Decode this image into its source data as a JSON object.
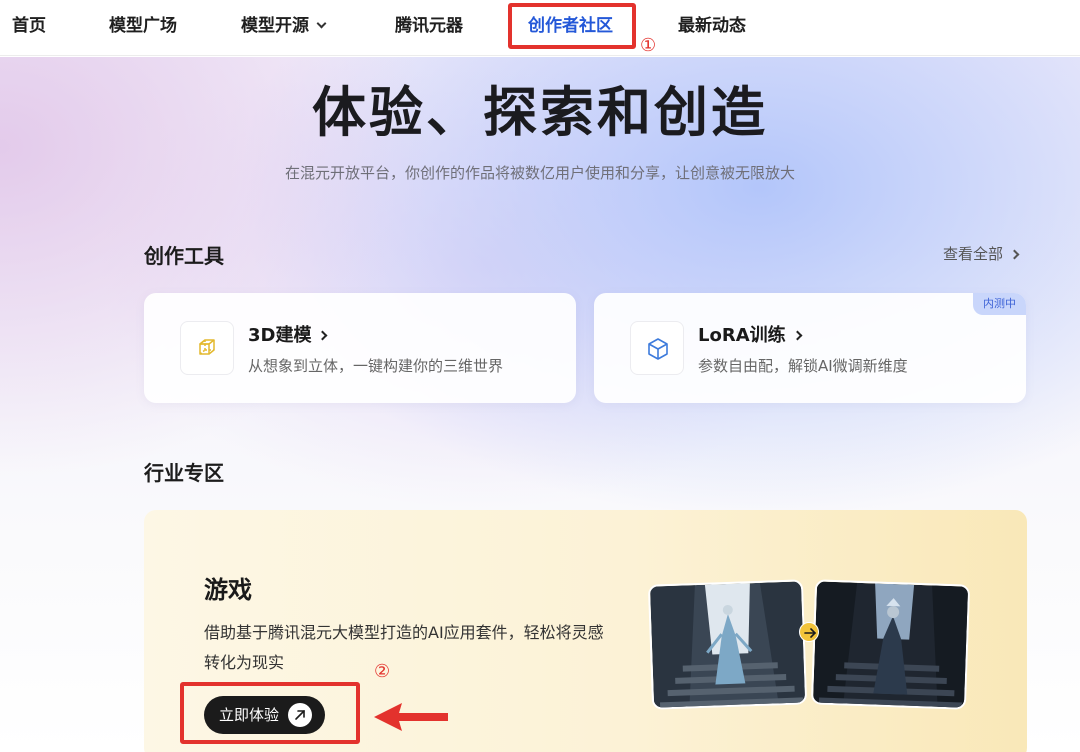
{
  "nav": {
    "items": [
      "首页",
      "模型广场",
      "模型开源",
      "腾讯元器",
      "创作者社区",
      "最新动态"
    ],
    "active_index": 4,
    "active_color": "#2458d8"
  },
  "annotations": {
    "marker_1": "①",
    "marker_2": "②",
    "color": "#e3322d"
  },
  "hero": {
    "title": "体验、探索和创造",
    "subtitle": "在混元开放平台，你创作的作品将被数亿用户使用和分享，让创意被无限放大"
  },
  "tools_section": {
    "title": "创作工具",
    "view_all": "查看全部",
    "cards": [
      {
        "name": "3D建模",
        "desc": "从想象到立体，一键构建你的三维世界",
        "icon": "cube-wireframe-icon"
      },
      {
        "name": "LoRA训练",
        "desc": "参数自由配，解锁AI微调新维度",
        "icon": "cube-icon",
        "badge": "内测中"
      }
    ]
  },
  "industry_section": {
    "title": "行业专区",
    "game": {
      "title": "游戏",
      "desc": "借助基于腾讯混元大模型打造的AI应用套件，轻松将灵感转化为现实",
      "button": "立即体验",
      "accent": "#f3c43a"
    }
  }
}
